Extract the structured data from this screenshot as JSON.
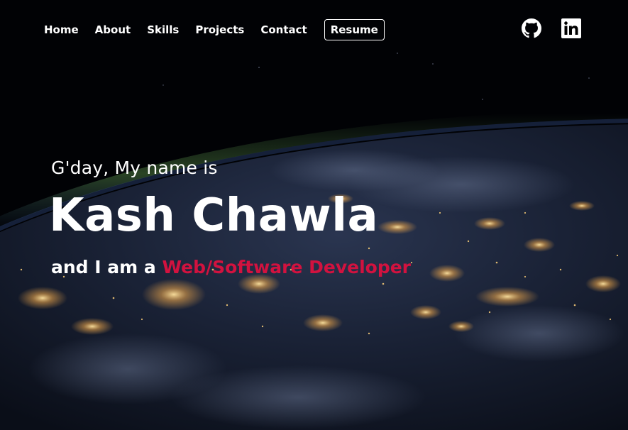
{
  "nav": {
    "links": [
      "Home",
      "About",
      "Skills",
      "Projects",
      "Contact"
    ],
    "resume_label": "Resume"
  },
  "social": {
    "github_icon": "github-icon",
    "linkedin_icon": "linkedin-icon"
  },
  "hero": {
    "greeting": "G'day, My name is",
    "name": "Kash Chawla",
    "tagline_prefix": "and I am a ",
    "role": "Web/Software Developer"
  },
  "colors": {
    "accent": "#d2123f",
    "text": "#ffffff",
    "background": "#020308"
  }
}
